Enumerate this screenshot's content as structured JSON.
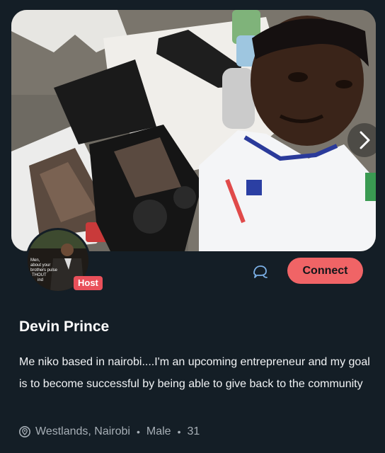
{
  "profile": {
    "name": "Devin Prince",
    "role_badge": "Host",
    "bio": "Me niko based in nairobi....I'm an upcoming entrepreneur and my goal is to become successful by being able to give back to the community",
    "location": "Westlands, Nairobi",
    "gender": "Male",
    "age": "31",
    "separator": "•"
  },
  "actions": {
    "connect_label": "Connect"
  },
  "avatar_caption_lines": [
    "Men,",
    "about your",
    "brothers pulse",
    "THOUT",
    "ind"
  ],
  "icons": {
    "next": "chevron-right-icon",
    "chat": "chat-bubbles-icon",
    "location": "location-pin-icon"
  },
  "colors": {
    "background": "#141e26",
    "accent": "#f06466",
    "badge": "#e9505a",
    "muted_text": "#a7afb6"
  }
}
